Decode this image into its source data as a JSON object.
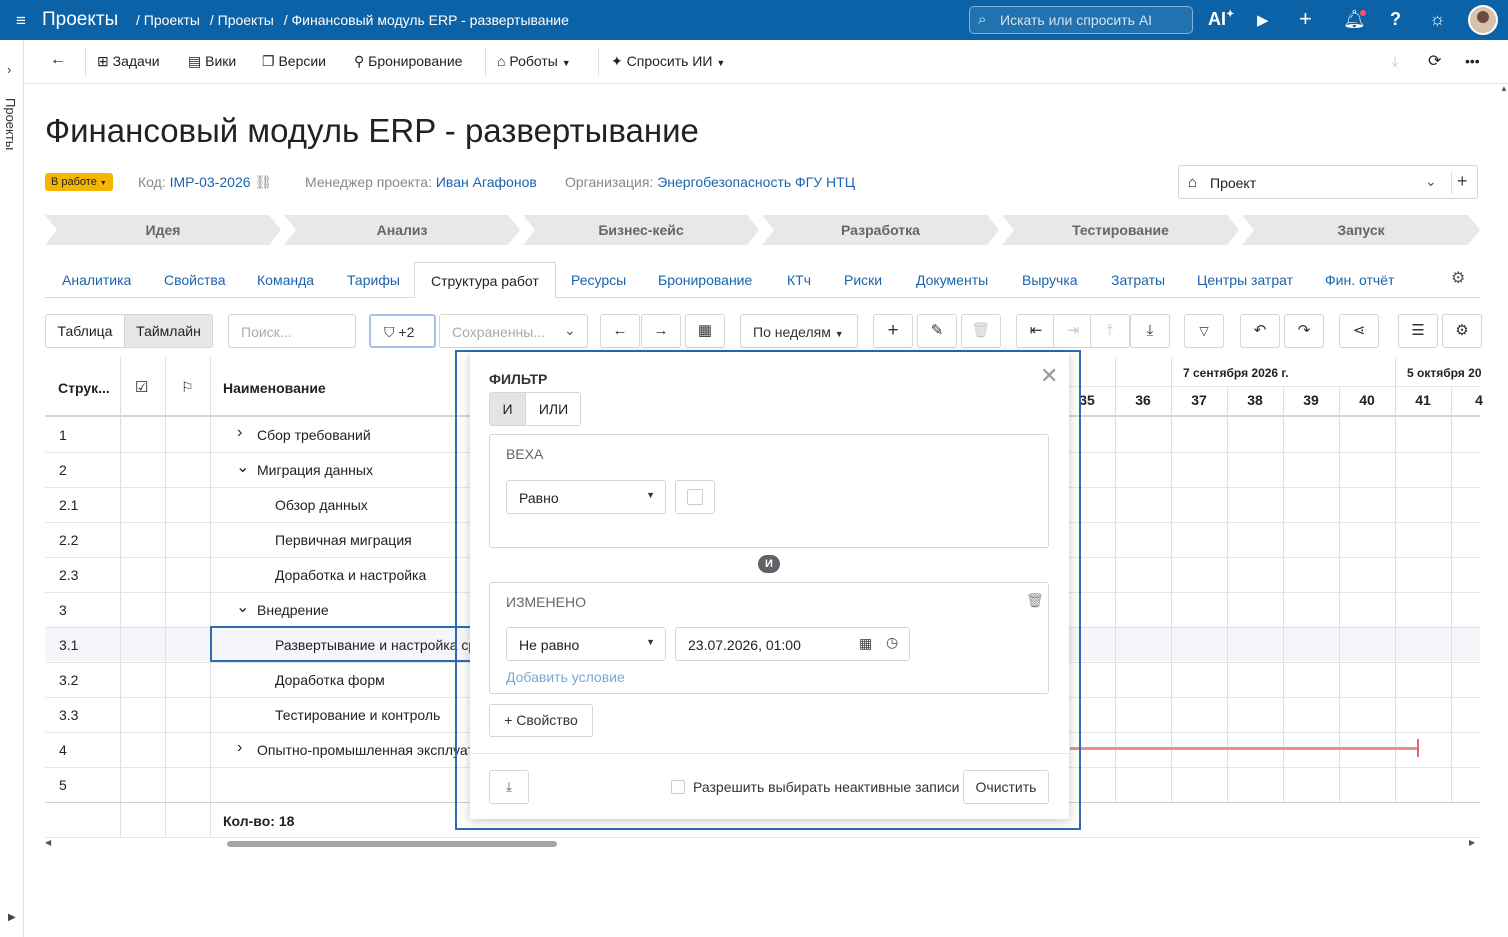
{
  "topbar": {
    "app_title": "Проекты",
    "breadcrumbs": [
      "/ Проекты",
      "/ Проекты",
      "/ Финансовый модуль ERP - развертывание"
    ],
    "search_placeholder": "Искать или спросить AI",
    "ai_label": "AI",
    "help_label": "?"
  },
  "rail": {
    "label": "Проекты"
  },
  "toolbar": {
    "back": "←",
    "tasks": "Задачи",
    "wiki": "Вики",
    "versions": "Версии",
    "booking": "Бронирование",
    "robots": "Роботы",
    "ask_ai": "Спросить ИИ"
  },
  "project": {
    "title": "Финансовый модуль ERP - развертывание",
    "status": "В работе",
    "code_label": "Код:",
    "code": "IMP-03-2026",
    "manager_label": "Менеджер проекта:",
    "manager": "Иван Агафонов",
    "org_label": "Организация:",
    "org": "Энергобезопасность ФГУ НТЦ",
    "type_select": "Проект"
  },
  "stages": [
    "Идея",
    "Анализ",
    "Бизнес-кейс",
    "Разработка",
    "Тестирование",
    "Запуск"
  ],
  "tabs": [
    "Аналитика",
    "Свойства",
    "Команда",
    "Тарифы",
    "Структура работ",
    "Ресурсы",
    "Бронирование",
    "КТч",
    "Риски",
    "Документы",
    "Выручка",
    "Затраты",
    "Центры затрат",
    "Фин. отчёт"
  ],
  "active_tab": "Структура работ",
  "view": {
    "table": "Таблица",
    "timeline": "Таймлайн",
    "search_placeholder": "Поиск...",
    "filter_count": "+2",
    "saved_placeholder": "Сохраненны...",
    "period": "По неделям"
  },
  "table": {
    "headers": {
      "structure": "Струк...",
      "name": "Наименование"
    },
    "rows": [
      {
        "num": "1",
        "name": "Сбор требований",
        "level": 0,
        "expand": "›"
      },
      {
        "num": "2",
        "name": "Миграция данных",
        "level": 0,
        "expand": "⌄"
      },
      {
        "num": "2.1",
        "name": "Обзор данных",
        "level": 1,
        "expand": ""
      },
      {
        "num": "2.2",
        "name": "Первичная миграция",
        "level": 1,
        "expand": ""
      },
      {
        "num": "2.3",
        "name": "Доработка и настройка",
        "level": 1,
        "expand": ""
      },
      {
        "num": "3",
        "name": "Внедрение",
        "level": 0,
        "expand": "⌄"
      },
      {
        "num": "3.1",
        "name": "Развертывание и настройка ср",
        "level": 1,
        "expand": ""
      },
      {
        "num": "3.2",
        "name": "Доработка форм",
        "level": 1,
        "expand": ""
      },
      {
        "num": "3.3",
        "name": "Тестирование и контроль",
        "level": 1,
        "expand": ""
      },
      {
        "num": "4",
        "name": "Опытно-промышленная эксплуат",
        "level": 0,
        "expand": "›"
      },
      {
        "num": "5",
        "name": "",
        "level": 0,
        "expand": ""
      }
    ],
    "footer": "Кол-во: 18"
  },
  "timeline": {
    "months": [
      "7 сентября 2026 г.",
      "5 октября 20"
    ],
    "weeks": [
      "35",
      "36",
      "37",
      "38",
      "39",
      "40",
      "41",
      "4"
    ]
  },
  "filter": {
    "title": "ФИЛЬТР",
    "and": "И",
    "or": "ИЛИ",
    "cond1": {
      "field": "ВЕХА",
      "op": "Равно"
    },
    "joiner": "И",
    "cond2": {
      "field": "ИЗМЕНЕНО",
      "op": "Не равно",
      "value": "23.07.2026, 01:00"
    },
    "add_condition": "Добавить условие",
    "add_property": "+ Свойство",
    "inactive_label": "Разрешить выбирать неактивные записи",
    "clear": "Очистить"
  }
}
